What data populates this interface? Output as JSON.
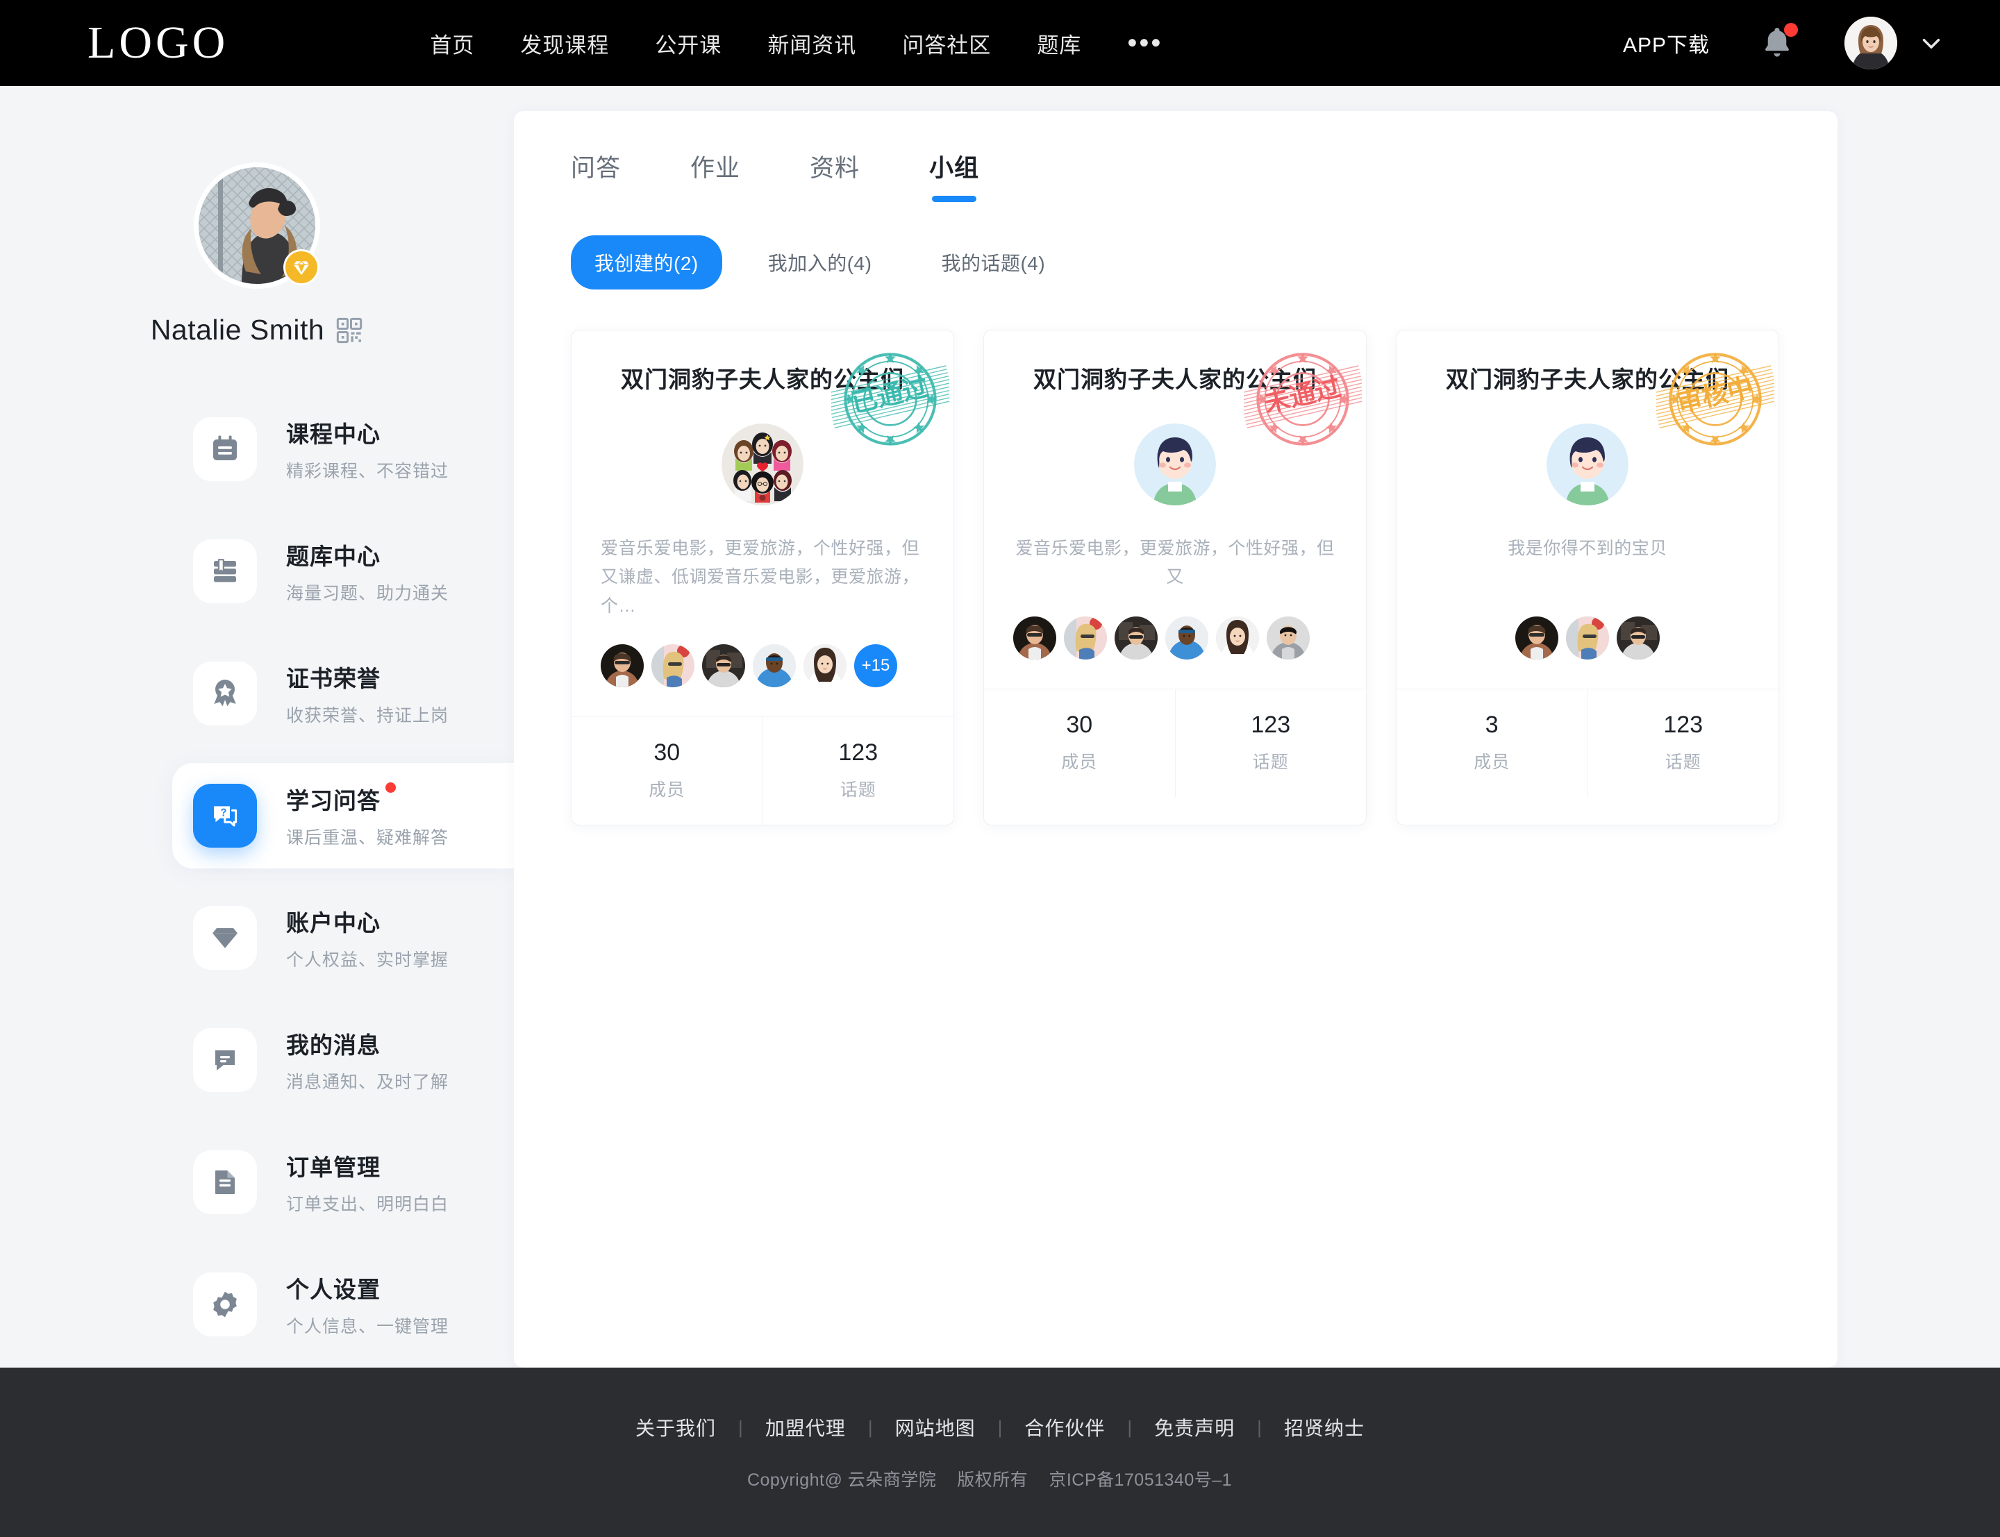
{
  "topnav": {
    "logo": "LOGO",
    "items": [
      {
        "label": "首页"
      },
      {
        "label": "发现课程"
      },
      {
        "label": "公开课"
      },
      {
        "label": "新闻资讯"
      },
      {
        "label": "问答社区"
      },
      {
        "label": "题库"
      }
    ],
    "more_label": "•••",
    "app_download": "APP下载",
    "bell_icon": "bell-icon",
    "bell_has_badge": true,
    "avatar_icon": "user-avatar",
    "chevron_icon": "chevron-down-icon",
    "background": "#000000"
  },
  "sidebar": {
    "profile": {
      "name": "Natalie Smith",
      "vip_badge_icon": "diamond-icon",
      "vip_badge_color": "#f5b826",
      "qr_icon": "qrcode-icon"
    },
    "items": [
      {
        "title": "课程中心",
        "sub": "精彩课程、不容错过",
        "icon": "calendar-icon",
        "active": false,
        "dot": false
      },
      {
        "title": "题库中心",
        "sub": "海量习题、助力通关",
        "icon": "books-icon",
        "active": false,
        "dot": false
      },
      {
        "title": "证书荣誉",
        "sub": "收获荣誉、持证上岗",
        "icon": "medal-star-icon",
        "active": false,
        "dot": false
      },
      {
        "title": "学习问答",
        "sub": "课后重温、疑难解答",
        "icon": "question-chat-icon",
        "active": true,
        "dot": true
      },
      {
        "title": "账户中心",
        "sub": "个人权益、实时掌握",
        "icon": "diamond-icon",
        "active": false,
        "dot": false
      },
      {
        "title": "我的消息",
        "sub": "消息通知、及时了解",
        "icon": "chat-bubble-icon",
        "active": false,
        "dot": false
      },
      {
        "title": "订单管理",
        "sub": "订单支出、明明白白",
        "icon": "document-icon",
        "active": false,
        "dot": false
      },
      {
        "title": "个人设置",
        "sub": "个人信息、一键管理",
        "icon": "gear-icon",
        "active": false,
        "dot": false
      }
    ],
    "active_color": "#1989fa"
  },
  "main": {
    "tabs": [
      {
        "label": "问答",
        "active": false
      },
      {
        "label": "作业",
        "active": false
      },
      {
        "label": "资料",
        "active": false
      },
      {
        "label": "小组",
        "active": true
      }
    ],
    "filters": [
      {
        "label": "我创建的(2)",
        "active": true
      },
      {
        "label": "我加入的(4)",
        "active": false
      },
      {
        "label": "我的话题(4)",
        "active": false
      }
    ],
    "cards": [
      {
        "title": "双门洞豹子夫人家的公主们",
        "stamp_text": "已通过",
        "stamp_color": "#3cb9ae",
        "avatar_icon": "group-photo-avatar",
        "desc": "爱音乐爱电影，更爱旅游，个性好强，但又谦虚、低调爱音乐爱电影，更爱旅游，个…",
        "desc_centered": false,
        "member_avatars": [
          "member-avatar-1",
          "member-avatar-2",
          "member-avatar-3",
          "member-avatar-4",
          "member-avatar-5"
        ],
        "more_members": "+15",
        "stats": [
          {
            "num": "30",
            "label": "成员"
          },
          {
            "num": "123",
            "label": "话题"
          }
        ]
      },
      {
        "title": "双门洞豹子夫人家的公主们",
        "stamp_text": "未通过",
        "stamp_color": "#f2868a",
        "avatar_icon": "boy-cartoon-avatar",
        "desc": "爱音乐爱电影，更爱旅游，个性好强，但又",
        "desc_centered": true,
        "member_avatars": [
          "member-avatar-1",
          "member-avatar-2",
          "member-avatar-3",
          "member-avatar-4",
          "member-avatar-5",
          "member-avatar-6"
        ],
        "more_members": "",
        "stats": [
          {
            "num": "30",
            "label": "成员"
          },
          {
            "num": "123",
            "label": "话题"
          }
        ]
      },
      {
        "title": "双门洞豹子夫人家的公主们",
        "stamp_text": "审核中",
        "stamp_color": "#f2ae3c",
        "avatar_icon": "boy-cartoon-avatar",
        "desc": "我是你得不到的宝贝",
        "desc_centered": true,
        "member_avatars": [
          "member-avatar-1",
          "member-avatar-2",
          "member-avatar-3"
        ],
        "more_members": "",
        "stats": [
          {
            "num": "3",
            "label": "成员"
          },
          {
            "num": "123",
            "label": "话题"
          }
        ]
      }
    ]
  },
  "footer": {
    "links": [
      "关于我们",
      "加盟代理",
      "网站地图",
      "合作伙伴",
      "免责声明",
      "招贤纳士"
    ],
    "separator": "|",
    "copyright": "Copyright@ 云朵商学院",
    "rights": "版权所有",
    "icp": "京ICP备17051340号–1",
    "background": "#2b2d31"
  }
}
